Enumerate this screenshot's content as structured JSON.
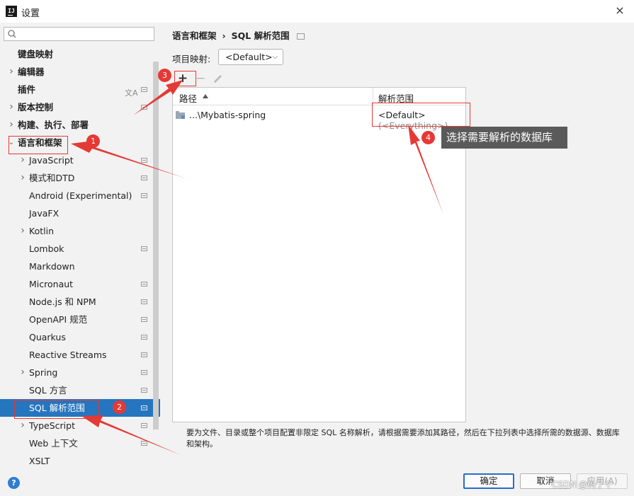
{
  "window": {
    "title": "设置",
    "close_icon": "×",
    "app_icon_text": "IJ"
  },
  "sidebar": {
    "search_placeholder": "",
    "items": [
      {
        "label": "键盘映射",
        "level": 0,
        "bold": true,
        "expandable": false,
        "marker": false
      },
      {
        "label": "编辑器",
        "level": 0,
        "bold": true,
        "expandable": true,
        "expanded": false,
        "marker": false
      },
      {
        "label": "插件",
        "level": 0,
        "bold": true,
        "expandable": false,
        "marker": true,
        "translate_icon": "文A"
      },
      {
        "label": "版本控制",
        "level": 0,
        "bold": true,
        "expandable": true,
        "expanded": false,
        "marker": true
      },
      {
        "label": "构建、执行、部署",
        "level": 0,
        "bold": true,
        "expandable": true,
        "expanded": false,
        "marker": false
      },
      {
        "label": "语言和框架",
        "level": 0,
        "bold": true,
        "expandable": true,
        "expanded": true,
        "marker": false
      },
      {
        "label": "JavaScript",
        "level": 1,
        "expandable": true,
        "marker": true
      },
      {
        "label": "模式和DTD",
        "level": 1,
        "expandable": true,
        "marker": true
      },
      {
        "label": "Android (Experimental)",
        "level": 1,
        "expandable": false,
        "marker": true
      },
      {
        "label": "JavaFX",
        "level": 1,
        "expandable": false,
        "marker": false
      },
      {
        "label": "Kotlin",
        "level": 1,
        "expandable": true,
        "marker": false
      },
      {
        "label": "Lombok",
        "level": 1,
        "expandable": false,
        "marker": true
      },
      {
        "label": "Markdown",
        "level": 1,
        "expandable": false,
        "marker": false
      },
      {
        "label": "Micronaut",
        "level": 1,
        "expandable": false,
        "marker": true
      },
      {
        "label": "Node.js 和 NPM",
        "level": 1,
        "expandable": false,
        "marker": true
      },
      {
        "label": "OpenAPI 规范",
        "level": 1,
        "expandable": false,
        "marker": true
      },
      {
        "label": "Quarkus",
        "level": 1,
        "expandable": false,
        "marker": true
      },
      {
        "label": "Reactive Streams",
        "level": 1,
        "expandable": false,
        "marker": true
      },
      {
        "label": "Spring",
        "level": 1,
        "expandable": true,
        "marker": true
      },
      {
        "label": "SQL 方言",
        "level": 1,
        "expandable": false,
        "marker": true
      },
      {
        "label": "SQL 解析范围",
        "level": 1,
        "expandable": false,
        "marker": true,
        "selected": true
      },
      {
        "label": "TypeScript",
        "level": 1,
        "expandable": true,
        "marker": true
      },
      {
        "label": "Web 上下文",
        "level": 1,
        "expandable": false,
        "marker": true
      },
      {
        "label": "XSLT",
        "level": 1,
        "expandable": false,
        "marker": false
      }
    ]
  },
  "main": {
    "breadcrumb": {
      "parent": "语言和框架",
      "separator": "›",
      "current": "SQL 解析范围"
    },
    "project_mapping": {
      "label": "项目映射:",
      "value": "<Default>"
    },
    "toolbar": {
      "add": "+",
      "remove": "−",
      "edit_icon": "pencil-icon"
    },
    "table": {
      "columns": [
        "路径",
        "解析范围"
      ],
      "rows": [
        {
          "path": "...\\Mybatis-spring",
          "scope": "<Default>",
          "scope_hint": "(<Everything>)"
        }
      ]
    },
    "help_text": "要为文件、目录或整个项目配置非限定 SQL 名称解析，请根据需要添加其路径，然后在下拉列表中选择所需的数据源、数据库和架构。"
  },
  "footer": {
    "help": "?",
    "ok": "确定",
    "cancel": "取消",
    "apply": "应用(A)"
  },
  "annotations": {
    "badges": [
      "1",
      "2",
      "3",
      "4"
    ],
    "tooltip": "选择需要解析的数据库",
    "color": "#e53935"
  },
  "watermark": "CSDN @码了个"
}
